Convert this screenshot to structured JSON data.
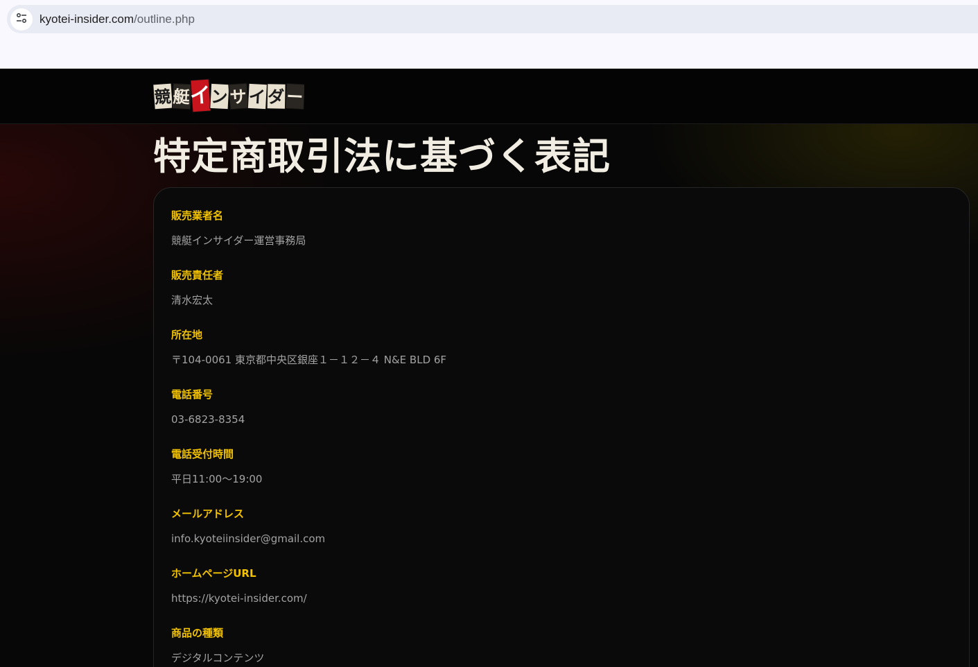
{
  "browser": {
    "url_host": "kyotei-insider.com",
    "url_path": "/outline.php",
    "site_info_icon": "tune-icon"
  },
  "site": {
    "logo_text": "競艇インサイダー"
  },
  "page": {
    "title": "特定商取引法に基づく表記"
  },
  "outline": [
    {
      "label": "販売業者名",
      "value": "競艇インサイダー運営事務局"
    },
    {
      "label": "販売責任者",
      "value": "清水宏太"
    },
    {
      "label": "所在地",
      "value": "〒104-0061 東京都中央区銀座１－１２－４ N&E BLD 6F"
    },
    {
      "label": "電話番号",
      "value": "03-6823-8354"
    },
    {
      "label": "電話受付時間",
      "value": "平日11:00〜19:00"
    },
    {
      "label": "メールアドレス",
      "value": "info.kyoteiinsider@gmail.com"
    },
    {
      "label": "ホームページURL",
      "value": "https://kyotei-insider.com/"
    },
    {
      "label": "商品の種類",
      "value": "デジタルコンテンツ"
    }
  ],
  "colors": {
    "label": "#f2c200",
    "value": "#a3a3a3",
    "background": "#070707",
    "logo_red": "#c8141c"
  }
}
